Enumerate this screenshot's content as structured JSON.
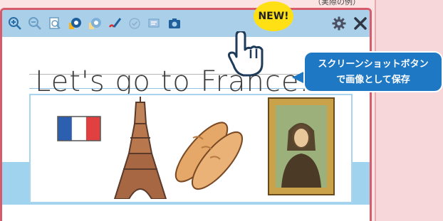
{
  "caption": "（実際の例）",
  "toolbar": {
    "icons": [
      "zoom-in",
      "zoom-out",
      "fit-page",
      "pen-color",
      "pen-outline",
      "marker",
      "check",
      "answer",
      "screenshot"
    ],
    "badge": "NEW!"
  },
  "page": {
    "handwriting": "Let's go to France."
  },
  "tooltip": {
    "line1": "スクリーンショットボタン",
    "line2": "で画像として保存"
  },
  "colors": {
    "toolbar": "#a9cfe9",
    "frame": "#d65c6b",
    "tooltip": "#1f78c4",
    "badge": "#ffe014"
  }
}
